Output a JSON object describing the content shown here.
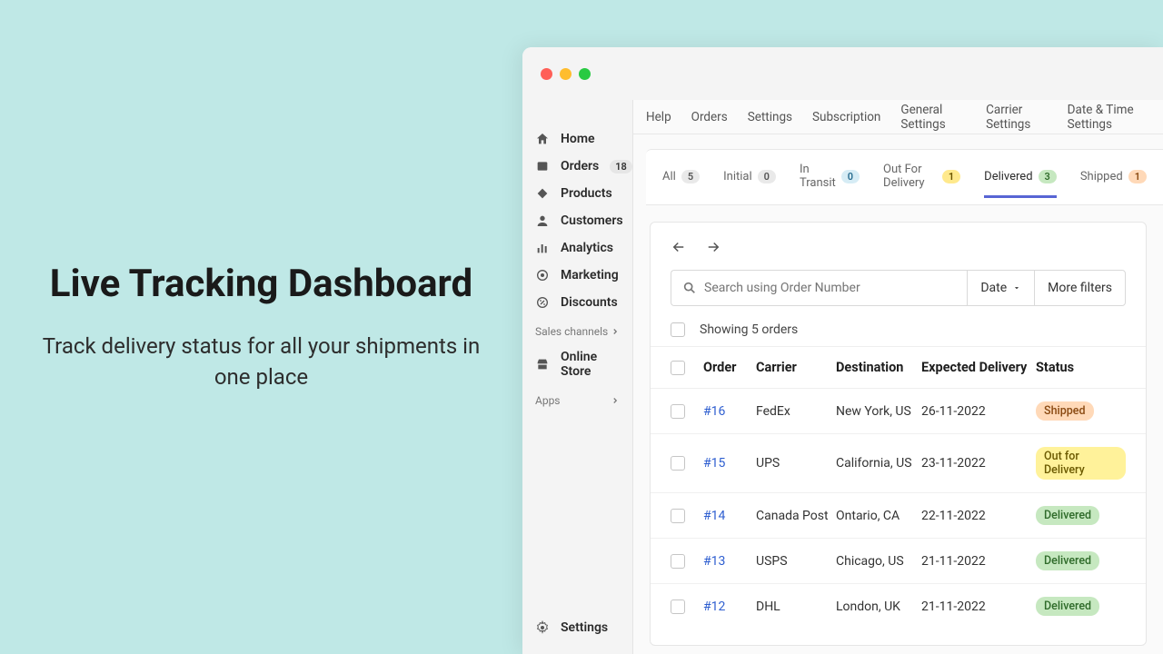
{
  "hero": {
    "title": "Live Tracking Dashboard",
    "subtitle": "Track delivery status for all your shipments in one place"
  },
  "sidebar": {
    "items": [
      {
        "label": "Home"
      },
      {
        "label": "Orders",
        "badge": "18"
      },
      {
        "label": "Products"
      },
      {
        "label": "Customers"
      },
      {
        "label": "Analytics"
      },
      {
        "label": "Marketing"
      },
      {
        "label": "Discounts"
      }
    ],
    "sales_channels_label": "Sales channels",
    "online_store_label": "Online Store",
    "apps_label": "Apps",
    "settings_label": "Settings"
  },
  "topnav": {
    "items": [
      "Help",
      "Orders",
      "Settings",
      "Subscription",
      "General Settings",
      "Carrier Settings",
      "Date & Time Settings"
    ]
  },
  "tabs": [
    {
      "label": "All",
      "count": "5",
      "pill": "gray"
    },
    {
      "label": "Initial",
      "count": "0",
      "pill": "gray"
    },
    {
      "label": "In Transit",
      "count": "0",
      "pill": "blue"
    },
    {
      "label": "Out For Delivery",
      "count": "1",
      "pill": "yellow"
    },
    {
      "label": "Delivered",
      "count": "3",
      "pill": "green",
      "active": true
    },
    {
      "label": "Shipped",
      "count": "1",
      "pill": "orange"
    }
  ],
  "search": {
    "placeholder": "Search using Order Number",
    "date_label": "Date",
    "more_filters_label": "More filters"
  },
  "showing_text": "Showing 5 orders",
  "columns": {
    "order": "Order",
    "carrier": "Carrier",
    "destination": "Destination",
    "expected": "Expected Delivery",
    "status": "Status"
  },
  "rows": [
    {
      "order": "#16",
      "carrier": "FedEx",
      "dest": "New York, US",
      "exp": "26-11-2022",
      "status": "Shipped",
      "cls": "shipped"
    },
    {
      "order": "#15",
      "carrier": "UPS",
      "dest": "California, US",
      "exp": "23-11-2022",
      "status": "Out for Delivery",
      "cls": "out"
    },
    {
      "order": "#14",
      "carrier": "Canada Post",
      "dest": "Ontario, CA",
      "exp": "22-11-2022",
      "status": "Delivered",
      "cls": "delivered"
    },
    {
      "order": "#13",
      "carrier": "USPS",
      "dest": "Chicago, US",
      "exp": "21-11-2022",
      "status": "Delivered",
      "cls": "delivered"
    },
    {
      "order": "#12",
      "carrier": "DHL",
      "dest": "London, UK",
      "exp": "21-11-2022",
      "status": "Delivered",
      "cls": "delivered"
    }
  ]
}
